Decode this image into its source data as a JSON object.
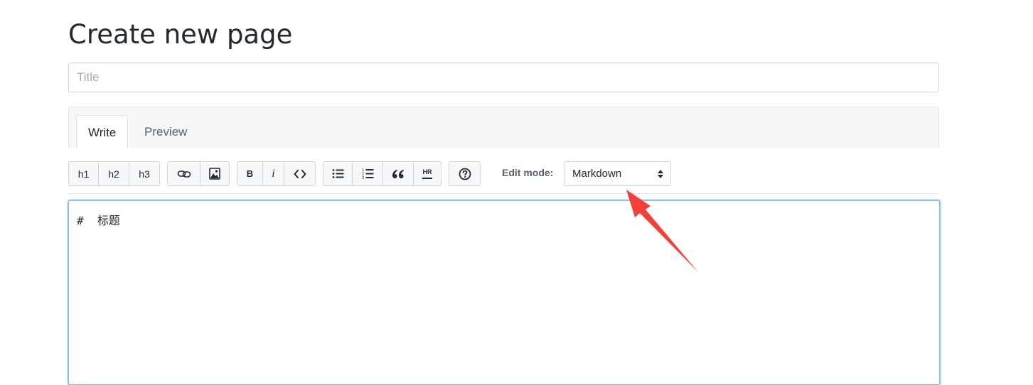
{
  "page": {
    "title": "Create new page"
  },
  "title_field": {
    "placeholder": "Title",
    "value": ""
  },
  "tabs": [
    {
      "label": "Write",
      "active": true
    },
    {
      "label": "Preview",
      "active": false
    }
  ],
  "toolbar": {
    "headers": [
      "h1",
      "h2",
      "h3"
    ],
    "insert": [
      {
        "icon": "link-icon"
      },
      {
        "icon": "image-icon"
      }
    ],
    "format": [
      {
        "label": "B"
      },
      {
        "label": "i"
      },
      {
        "icon": "code-icon"
      }
    ],
    "blocks": [
      {
        "icon": "unordered-list-icon"
      },
      {
        "icon": "ordered-list-icon"
      },
      {
        "icon": "quote-icon"
      },
      {
        "label": "HR"
      }
    ],
    "help": {
      "icon": "question-icon"
    },
    "edit_mode_label": "Edit mode:",
    "edit_mode_value": "Markdown"
  },
  "editor": {
    "content": "#  标题"
  },
  "annotation": {
    "color": "#f5403a"
  }
}
